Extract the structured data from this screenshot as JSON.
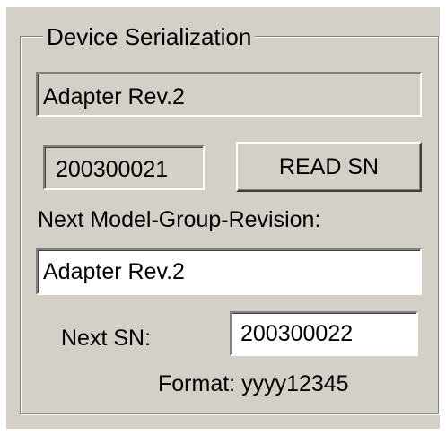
{
  "group": {
    "title": "Device Serialization"
  },
  "current_model": {
    "value": "Adapter Rev.2"
  },
  "current_sn": {
    "value": "200300021"
  },
  "read_sn_button": {
    "label": "READ SN"
  },
  "next_model": {
    "label": "Next Model-Group-Revision:",
    "value": "Adapter Rev.2"
  },
  "next_sn": {
    "label": "Next SN:",
    "value": "200300022"
  },
  "format": {
    "text": "Format: yyyy12345"
  },
  "colors": {
    "face": "#d4d0c8",
    "shadow": "#808080",
    "highlight": "#ffffff",
    "field": "#ffffff"
  }
}
